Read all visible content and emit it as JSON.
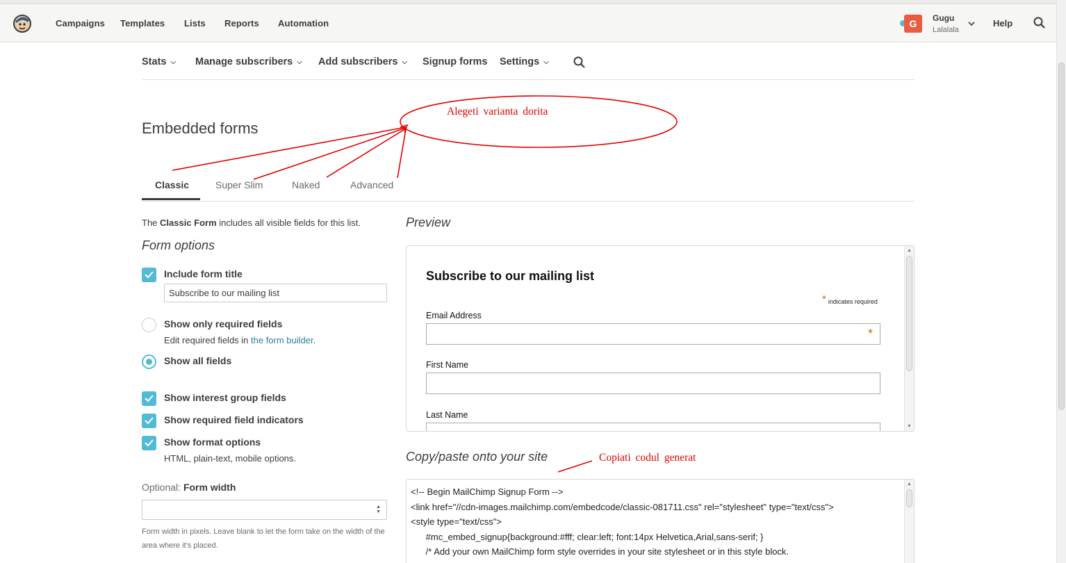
{
  "topnav": {
    "items": [
      "Campaigns",
      "Templates",
      "Lists",
      "Reports",
      "Automation"
    ],
    "active": "Lists",
    "user": {
      "initial": "G",
      "name": "Gugu",
      "account": "Lalalala"
    },
    "help": "Help",
    "icons": {
      "logo": "freddie-logo-icon",
      "search": "search-icon",
      "user_menu": "chevron-down-icon"
    }
  },
  "subnav": {
    "stats": "Stats",
    "manage": "Manage subscribers",
    "add": "Add subscribers",
    "signup": "Signup forms",
    "settings": "Settings"
  },
  "page": {
    "title": "Embedded forms"
  },
  "tabs": [
    "Classic",
    "Super Slim",
    "Naked",
    "Advanced"
  ],
  "intro": {
    "pre": "The ",
    "bold": "Classic Form",
    "post": " includes all visible fields for this list."
  },
  "form_options": {
    "heading": "Form options",
    "include_title": {
      "label": "Include form title",
      "checked": true,
      "value": "Subscribe to our mailing list"
    },
    "required_only": {
      "label": "Show only required fields",
      "selected": false,
      "sub_pre": "Edit required fields in ",
      "sub_link": "the form builder",
      "sub_post": "."
    },
    "all_fields": {
      "label": "Show all fields",
      "selected": true
    },
    "interest_groups": {
      "label": "Show interest group fields",
      "checked": true
    },
    "required_indicators": {
      "label": "Show required field indicators",
      "checked": true
    },
    "format_options": {
      "label": "Show format options",
      "checked": true,
      "sub": "HTML, plain-text, mobile options."
    },
    "width": {
      "optional": "Optional: ",
      "label": "Form width",
      "value": "",
      "help": "Form width in pixels. Leave blank to let the form take on the width of the area where it's placed."
    }
  },
  "preview": {
    "heading": "Preview",
    "form_title": "Subscribe to our mailing list",
    "required_note": "indicates required",
    "required_mark": "*",
    "fields": [
      "Email Address",
      "First Name",
      "Last Name"
    ]
  },
  "copy": {
    "heading": "Copy/paste onto your site",
    "code": [
      "<!-- Begin MailChimp Signup Form -->",
      "<link href=\"//cdn-images.mailchimp.com/embedcode/classic-081711.css\" rel=\"stylesheet\" type=\"text/css\">",
      "<style type=\"text/css\">",
      "      #mc_embed_signup{background:#fff; clear:left; font:14px Helvetica,Arial,sans-serif; }",
      "      /* Add your own MailChimp form style overrides in your site stylesheet or in this style block."
    ]
  },
  "annotations": {
    "choose": "Alegeti varianta dorita",
    "copy": "Copiati codul generat",
    "color": "#e00000"
  },
  "colors": {
    "accent": "#52bad5",
    "text": "#403b3b",
    "link": "#2b7fa1",
    "avatar": "#e85c41"
  }
}
